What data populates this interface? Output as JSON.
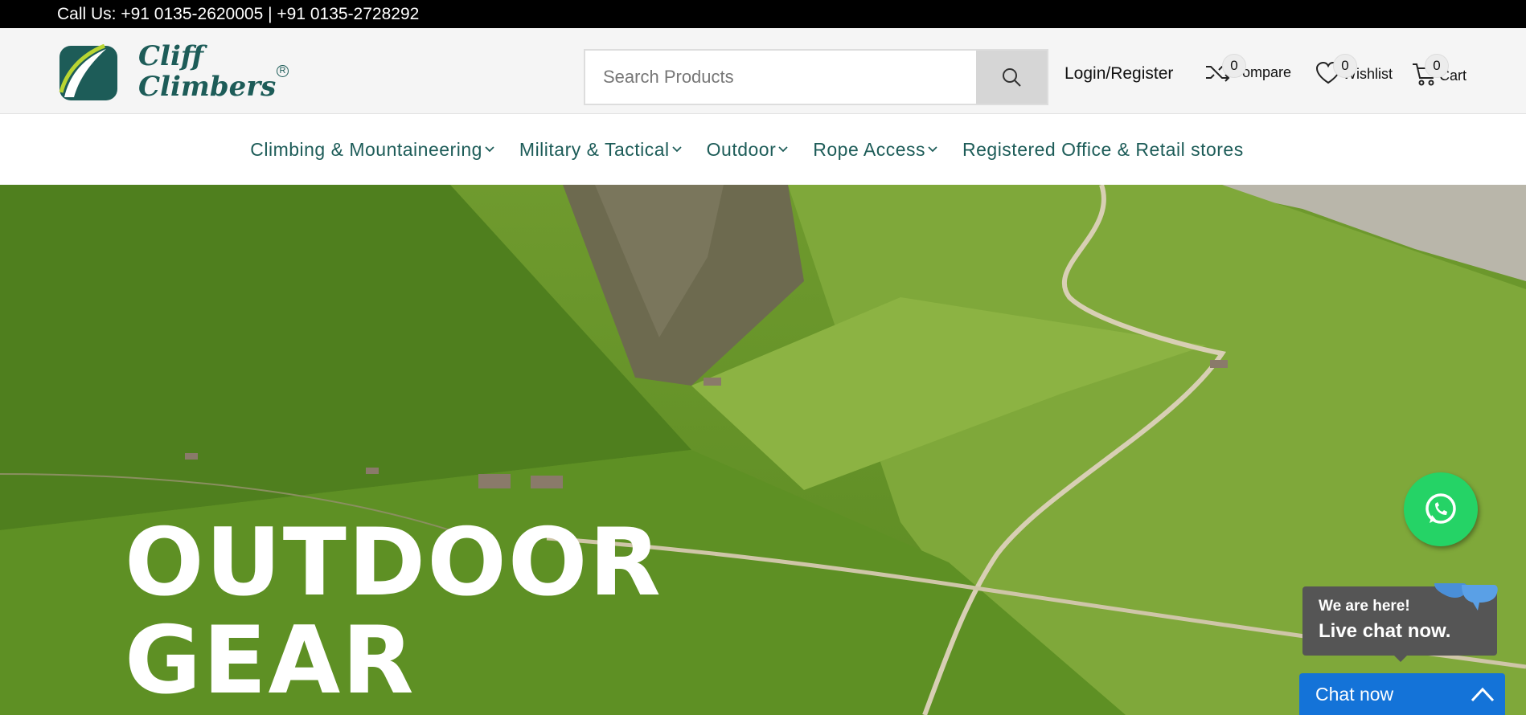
{
  "topbar": {
    "call_text": "Call Us: +91 0135-2620005 | +91 0135-2728292"
  },
  "logo": {
    "line1": "Cliff",
    "line2": "Climbers",
    "reg": "R"
  },
  "search": {
    "placeholder": "Search Products",
    "value": ""
  },
  "header": {
    "login_label": "Login/Register",
    "compare": {
      "label": "Compare",
      "count": "0",
      "icon": "shuffle-icon"
    },
    "wishlist": {
      "label": "Wishlist",
      "count": "0",
      "icon": "heart-icon"
    },
    "cart": {
      "label": "Cart",
      "count": "0",
      "icon": "cart-icon"
    }
  },
  "nav": {
    "items": [
      {
        "label": "Climbing & Mountaineering",
        "has_dropdown": true
      },
      {
        "label": "Military & Tactical",
        "has_dropdown": true
      },
      {
        "label": "Outdoor",
        "has_dropdown": true
      },
      {
        "label": "Rope Access",
        "has_dropdown": true
      },
      {
        "label": "Registered Office & Retail stores",
        "has_dropdown": false
      }
    ]
  },
  "hero": {
    "title_line1": "OUTDOOR",
    "title_line2": "GEAR"
  },
  "chat": {
    "bubble_line1": "We are here!",
    "bubble_line2": "Live chat now.",
    "button_label": "Chat now"
  },
  "colors": {
    "brand": "#1d5c58",
    "topbar": "#000000",
    "whatsapp": "#25d366",
    "chat_button": "#1473d8"
  }
}
